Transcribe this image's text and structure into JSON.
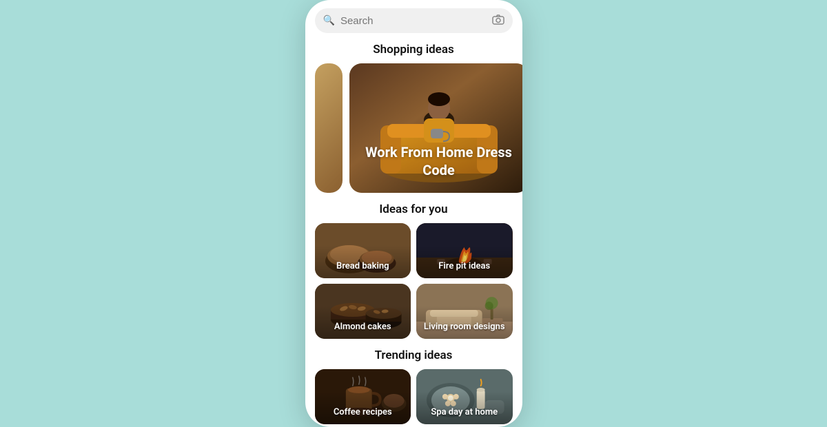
{
  "colors": {
    "background": "#a8ddd9",
    "phone_bg": "#ffffff",
    "search_bg": "#f0f0f0"
  },
  "search": {
    "placeholder": "Search"
  },
  "sections": {
    "shopping": {
      "title": "Shopping ideas",
      "cards": [
        {
          "id": "work-from-home",
          "label": "Work From Home\nDress Code"
        }
      ]
    },
    "ideas_for_you": {
      "title": "Ideas for you",
      "items": [
        {
          "id": "bread-baking",
          "label": "Bread baking"
        },
        {
          "id": "fire-pit-ideas",
          "label": "Fire pit ideas"
        },
        {
          "id": "almond-cakes",
          "label": "Almond cakes"
        },
        {
          "id": "living-room-designs",
          "label": "Living room designs"
        }
      ]
    },
    "trending": {
      "title": "Trending ideas",
      "items": [
        {
          "id": "coffee-recipes",
          "label": "Coffee recipes"
        },
        {
          "id": "spa-day-at-home",
          "label": "Spa day at home"
        }
      ]
    }
  }
}
